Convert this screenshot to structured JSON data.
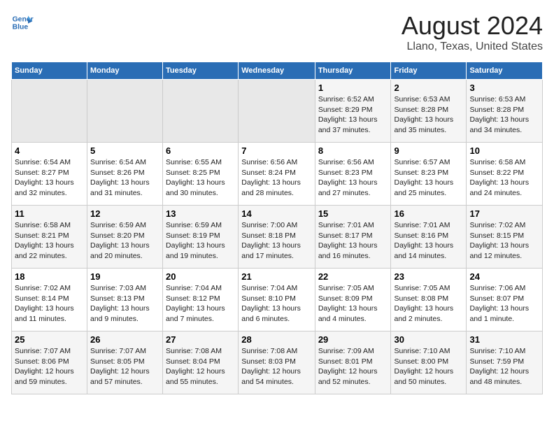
{
  "header": {
    "logo_line1": "General",
    "logo_line2": "Blue",
    "title": "August 2024",
    "subtitle": "Llano, Texas, United States"
  },
  "weekdays": [
    "Sunday",
    "Monday",
    "Tuesday",
    "Wednesday",
    "Thursday",
    "Friday",
    "Saturday"
  ],
  "weeks": [
    [
      {
        "day": "",
        "info": ""
      },
      {
        "day": "",
        "info": ""
      },
      {
        "day": "",
        "info": ""
      },
      {
        "day": "",
        "info": ""
      },
      {
        "day": "1",
        "info": "Sunrise: 6:52 AM\nSunset: 8:29 PM\nDaylight: 13 hours\nand 37 minutes."
      },
      {
        "day": "2",
        "info": "Sunrise: 6:53 AM\nSunset: 8:28 PM\nDaylight: 13 hours\nand 35 minutes."
      },
      {
        "day": "3",
        "info": "Sunrise: 6:53 AM\nSunset: 8:28 PM\nDaylight: 13 hours\nand 34 minutes."
      }
    ],
    [
      {
        "day": "4",
        "info": "Sunrise: 6:54 AM\nSunset: 8:27 PM\nDaylight: 13 hours\nand 32 minutes."
      },
      {
        "day": "5",
        "info": "Sunrise: 6:54 AM\nSunset: 8:26 PM\nDaylight: 13 hours\nand 31 minutes."
      },
      {
        "day": "6",
        "info": "Sunrise: 6:55 AM\nSunset: 8:25 PM\nDaylight: 13 hours\nand 30 minutes."
      },
      {
        "day": "7",
        "info": "Sunrise: 6:56 AM\nSunset: 8:24 PM\nDaylight: 13 hours\nand 28 minutes."
      },
      {
        "day": "8",
        "info": "Sunrise: 6:56 AM\nSunset: 8:23 PM\nDaylight: 13 hours\nand 27 minutes."
      },
      {
        "day": "9",
        "info": "Sunrise: 6:57 AM\nSunset: 8:23 PM\nDaylight: 13 hours\nand 25 minutes."
      },
      {
        "day": "10",
        "info": "Sunrise: 6:58 AM\nSunset: 8:22 PM\nDaylight: 13 hours\nand 24 minutes."
      }
    ],
    [
      {
        "day": "11",
        "info": "Sunrise: 6:58 AM\nSunset: 8:21 PM\nDaylight: 13 hours\nand 22 minutes."
      },
      {
        "day": "12",
        "info": "Sunrise: 6:59 AM\nSunset: 8:20 PM\nDaylight: 13 hours\nand 20 minutes."
      },
      {
        "day": "13",
        "info": "Sunrise: 6:59 AM\nSunset: 8:19 PM\nDaylight: 13 hours\nand 19 minutes."
      },
      {
        "day": "14",
        "info": "Sunrise: 7:00 AM\nSunset: 8:18 PM\nDaylight: 13 hours\nand 17 minutes."
      },
      {
        "day": "15",
        "info": "Sunrise: 7:01 AM\nSunset: 8:17 PM\nDaylight: 13 hours\nand 16 minutes."
      },
      {
        "day": "16",
        "info": "Sunrise: 7:01 AM\nSunset: 8:16 PM\nDaylight: 13 hours\nand 14 minutes."
      },
      {
        "day": "17",
        "info": "Sunrise: 7:02 AM\nSunset: 8:15 PM\nDaylight: 13 hours\nand 12 minutes."
      }
    ],
    [
      {
        "day": "18",
        "info": "Sunrise: 7:02 AM\nSunset: 8:14 PM\nDaylight: 13 hours\nand 11 minutes."
      },
      {
        "day": "19",
        "info": "Sunrise: 7:03 AM\nSunset: 8:13 PM\nDaylight: 13 hours\nand 9 minutes."
      },
      {
        "day": "20",
        "info": "Sunrise: 7:04 AM\nSunset: 8:12 PM\nDaylight: 13 hours\nand 7 minutes."
      },
      {
        "day": "21",
        "info": "Sunrise: 7:04 AM\nSunset: 8:10 PM\nDaylight: 13 hours\nand 6 minutes."
      },
      {
        "day": "22",
        "info": "Sunrise: 7:05 AM\nSunset: 8:09 PM\nDaylight: 13 hours\nand 4 minutes."
      },
      {
        "day": "23",
        "info": "Sunrise: 7:05 AM\nSunset: 8:08 PM\nDaylight: 13 hours\nand 2 minutes."
      },
      {
        "day": "24",
        "info": "Sunrise: 7:06 AM\nSunset: 8:07 PM\nDaylight: 13 hours\nand 1 minute."
      }
    ],
    [
      {
        "day": "25",
        "info": "Sunrise: 7:07 AM\nSunset: 8:06 PM\nDaylight: 12 hours\nand 59 minutes."
      },
      {
        "day": "26",
        "info": "Sunrise: 7:07 AM\nSunset: 8:05 PM\nDaylight: 12 hours\nand 57 minutes."
      },
      {
        "day": "27",
        "info": "Sunrise: 7:08 AM\nSunset: 8:04 PM\nDaylight: 12 hours\nand 55 minutes."
      },
      {
        "day": "28",
        "info": "Sunrise: 7:08 AM\nSunset: 8:03 PM\nDaylight: 12 hours\nand 54 minutes."
      },
      {
        "day": "29",
        "info": "Sunrise: 7:09 AM\nSunset: 8:01 PM\nDaylight: 12 hours\nand 52 minutes."
      },
      {
        "day": "30",
        "info": "Sunrise: 7:10 AM\nSunset: 8:00 PM\nDaylight: 12 hours\nand 50 minutes."
      },
      {
        "day": "31",
        "info": "Sunrise: 7:10 AM\nSunset: 7:59 PM\nDaylight: 12 hours\nand 48 minutes."
      }
    ]
  ]
}
